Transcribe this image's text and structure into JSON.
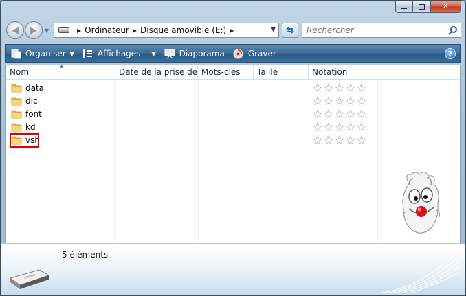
{
  "window": {
    "caption_buttons": {
      "minimize": "minimize-icon",
      "maximize": "maximize-icon",
      "close": "close-icon"
    }
  },
  "navigation": {
    "back_icon": "back-arrow-icon",
    "forward_icon": "forward-arrow-icon",
    "breadcrumbs": [
      "Ordinateur",
      "Disque amovible (E:)"
    ],
    "search_placeholder": "Rechercher"
  },
  "toolbar": {
    "organiser_label": "Organiser",
    "affichages_label": "Affichages",
    "diaporama_label": "Diaporama",
    "graver_label": "Graver",
    "help_label": "?"
  },
  "columns": [
    "Nom",
    "Date de la prise de ...",
    "Mots-clés",
    "Taille",
    "Notation"
  ],
  "files": [
    {
      "name": "data",
      "rating": 0
    },
    {
      "name": "dic",
      "rating": 0
    },
    {
      "name": "font",
      "rating": 0
    },
    {
      "name": "kd",
      "rating": 0
    },
    {
      "name": "vsh",
      "rating": 0
    }
  ],
  "status": {
    "item_count": "5 éléments"
  },
  "colors": {
    "command_bar": "#3f6f99",
    "highlight": "#e00000",
    "folder": "#f2c94c"
  }
}
